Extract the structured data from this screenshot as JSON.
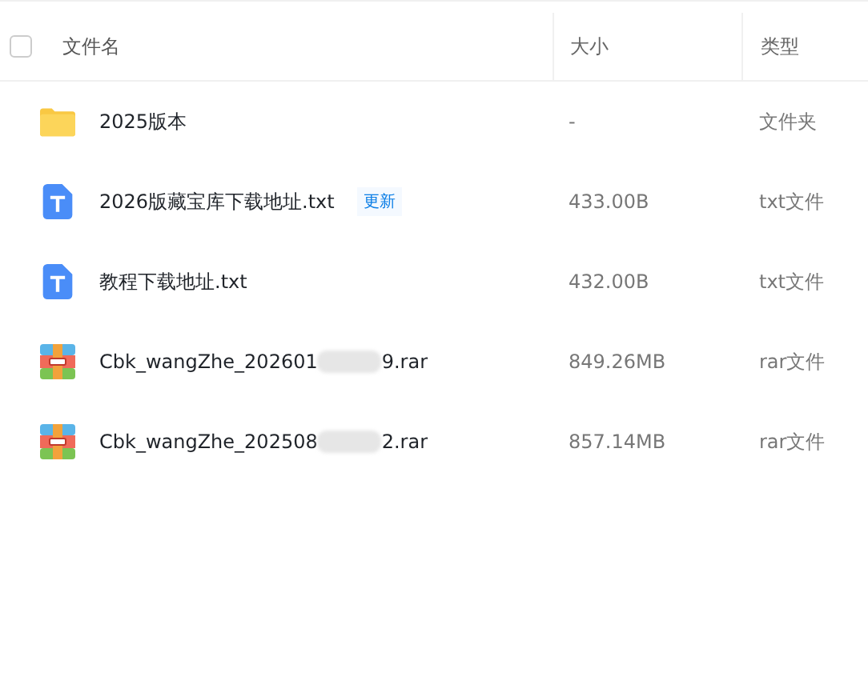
{
  "table": {
    "select_all": {
      "checked": false
    },
    "columns": [
      "文件名",
      "大小",
      "类型"
    ],
    "rows": [
      {
        "kind": "folder",
        "name": "2025版本",
        "size": "-",
        "type": "文件夹"
      },
      {
        "kind": "txt",
        "name": "2026版藏宝库下载地址.txt",
        "badge": "更新",
        "size": "433.00B",
        "type": "txt文件"
      },
      {
        "kind": "txt",
        "name": "教程下载地址.txt",
        "size": "432.00B",
        "type": "txt文件"
      },
      {
        "kind": "rar",
        "name": "Cbk_wangZhe_202601",
        "name_end": "9.rar",
        "size": "849.26MB",
        "type": "rar文件"
      },
      {
        "kind": "rar",
        "name": "Cbk_wangZhe_202508",
        "name_end": "2.rar",
        "size": "857.14MB",
        "type": "rar文件"
      }
    ]
  }
}
